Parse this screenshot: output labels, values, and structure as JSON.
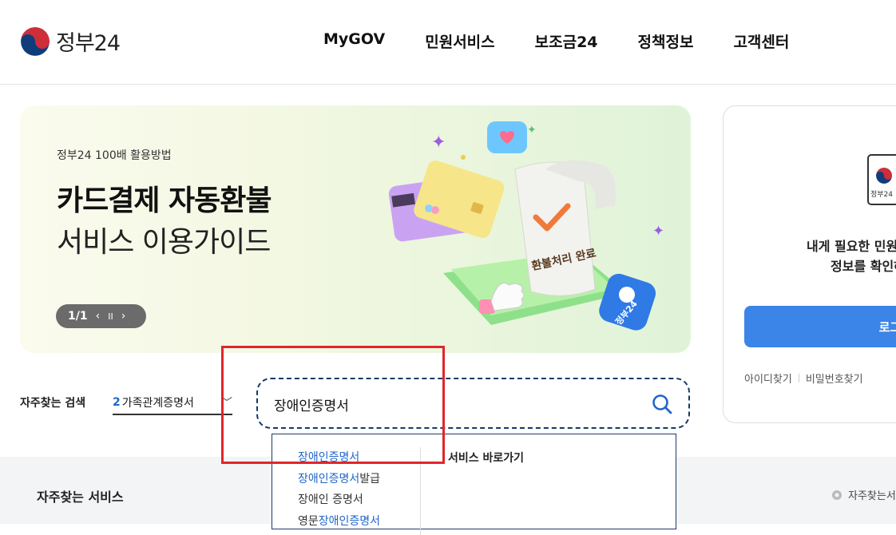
{
  "header": {
    "logo_text": "정부24",
    "nav": [
      "MyGOV",
      "민원서비스",
      "보조금24",
      "정책정보",
      "고객센터"
    ]
  },
  "banner": {
    "subtitle": "정부24 100배 활용방법",
    "title": "카드결제 자동환불",
    "title2": "서비스 이용가이드",
    "pager": "1/1",
    "illustration_label": "환불처리 완료",
    "badge_label": "정부24"
  },
  "login_card": {
    "icon_label": "정부24",
    "message_line1": "내게 필요한 민원",
    "message_line2": "정보를 확인하",
    "login_button": "로그인",
    "find_id": "아이디찾기",
    "find_password": "비밀번호찾기"
  },
  "search": {
    "freq_label": "자주찾는 검색",
    "rank_number": "2",
    "rank_term": "가족관계증명서",
    "query": "장애인증명서"
  },
  "dropdown": {
    "items": [
      {
        "hl": "장애인증명서",
        "rest": "",
        "prefix": ""
      },
      {
        "hl": "장애인증명서",
        "rest": "발급",
        "prefix": ""
      },
      {
        "hl": "",
        "rest": "장애인 증명서",
        "prefix": ""
      },
      {
        "hl": "장애인증명서",
        "rest": "",
        "prefix": "영문"
      }
    ],
    "shortcut_title": "서비스 바로가기"
  },
  "bottom": {
    "freq_services": "자주찾는 서비스",
    "freq_settings": "자주찾는서"
  },
  "colors": {
    "accent": "#3b84e8",
    "highlight": "#2066c8",
    "annotation_red": "#e0262a"
  }
}
